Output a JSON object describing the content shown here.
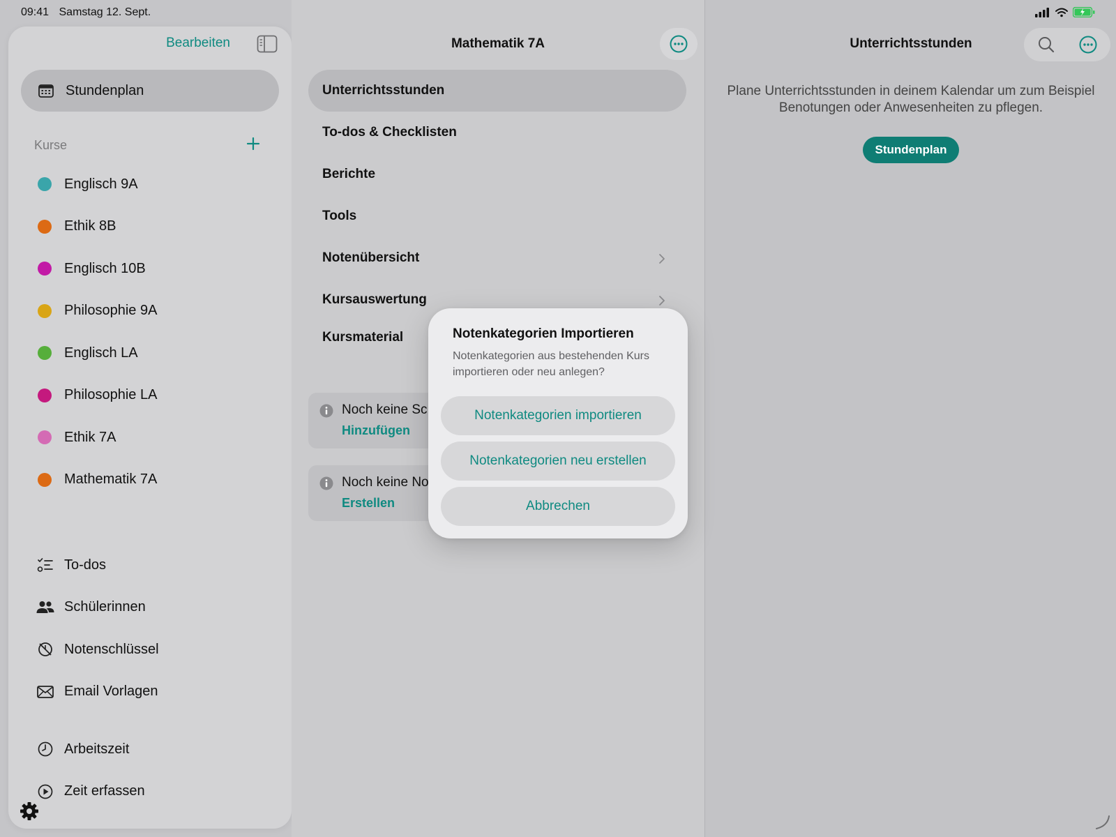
{
  "status_bar": {
    "time": "09:41",
    "date": "Samstag 12. Sept."
  },
  "sidebar": {
    "edit_label": "Bearbeiten",
    "selected_item": {
      "label": "Stundenplan",
      "icon": "calendar-icon"
    },
    "section_label": "Kurse",
    "courses": [
      {
        "label": "Englisch 9A",
        "color": "#3aa5aa"
      },
      {
        "label": "Ethik 8B",
        "color": "#dc6a14"
      },
      {
        "label": "Englisch 10B",
        "color": "#c21aa6"
      },
      {
        "label": "Philosophie 9A",
        "color": "#d9a516"
      },
      {
        "label": "Englisch LA",
        "color": "#56ae3b"
      },
      {
        "label": "Philosophie LA",
        "color": "#c4197e"
      },
      {
        "label": "Ethik 7A",
        "color": "#d46bb4"
      },
      {
        "label": "Mathematik 7A",
        "color": "#dc6a14"
      }
    ],
    "tools": [
      {
        "label": "To-dos",
        "icon": "checklist-icon"
      },
      {
        "label": "Schülerinnen",
        "icon": "people-icon"
      },
      {
        "label": "Notenschlüssel",
        "icon": "grade-key-icon"
      },
      {
        "label": "Email Vorlagen",
        "icon": "envelope-icon"
      }
    ],
    "time_tools": [
      {
        "label": "Arbeitszeit",
        "icon": "clock-icon"
      },
      {
        "label": "Zeit erfassen",
        "icon": "play-circle-icon"
      }
    ]
  },
  "middle": {
    "title": "Mathematik 7A",
    "menu": [
      "Unterrichtsstunden",
      "To-dos & Checklisten",
      "Berichte",
      "Tools",
      "Notenübersicht",
      "Kursauswertung",
      "Kursmaterial"
    ],
    "info_cards": [
      {
        "text": "Noch keine Sc",
        "link": "Hinzufügen"
      },
      {
        "text": "Noch keine No",
        "link": "Erstellen"
      }
    ]
  },
  "right": {
    "title": "Unterrichtsstunden",
    "description": "Plane Unterrichtsstunden in deinem Kalendar um zum Beispiel Benotungen oder Anwesenheiten zu pflegen.",
    "button_label": "Stundenplan"
  },
  "dialog": {
    "title": "Notenkategorien Importieren",
    "message": "Notenkategorien aus bestehenden Kurs importieren oder neu anlegen?",
    "buttons": [
      "Notenkategorien importieren",
      "Notenkategorien neu erstellen",
      "Abbrechen"
    ]
  },
  "colors": {
    "accent": "#0f8a81",
    "primary_button": "#0f7d74",
    "battery": "#34c759"
  }
}
